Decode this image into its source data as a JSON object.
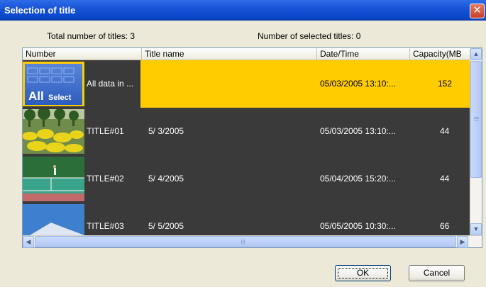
{
  "window": {
    "title": "Selection of title",
    "close_glyph": "✕"
  },
  "summary": {
    "total_label": "Total number of titles: 3",
    "selected_label": "Number of selected titles: 0"
  },
  "table": {
    "columns": [
      "Number",
      "Title name",
      "Date/Time",
      "Capacity(MB"
    ],
    "rows": [
      {
        "number": "All data in ...",
        "title": "",
        "datetime": "05/03/2005 13:10:...",
        "capacity": "152",
        "selected": true,
        "thumb": "all-select"
      },
      {
        "number": "TITLE#01",
        "title": "5/ 3/2005",
        "datetime": "05/03/2005 13:10:...",
        "capacity": "44",
        "selected": false,
        "thumb": "park"
      },
      {
        "number": "TITLE#02",
        "title": "5/ 4/2005",
        "datetime": "05/04/2005 15:20:...",
        "capacity": "44",
        "selected": false,
        "thumb": "tennis"
      },
      {
        "number": "TITLE#03",
        "title": "5/ 5/2005",
        "datetime": "05/05/2005 10:30:...",
        "capacity": "66",
        "selected": false,
        "thumb": "mountain"
      }
    ],
    "all_select_thumb": {
      "big": "All",
      "small": "Select"
    }
  },
  "scrollbars": {
    "up": "▲",
    "down": "▼",
    "left": "◀",
    "right": "▶"
  },
  "buttons": {
    "ok": "OK",
    "cancel": "Cancel"
  },
  "colors": {
    "selected_row": "#ffcc00",
    "row_bg": "#3a3a3a",
    "title_bar": "#0a46c8"
  }
}
